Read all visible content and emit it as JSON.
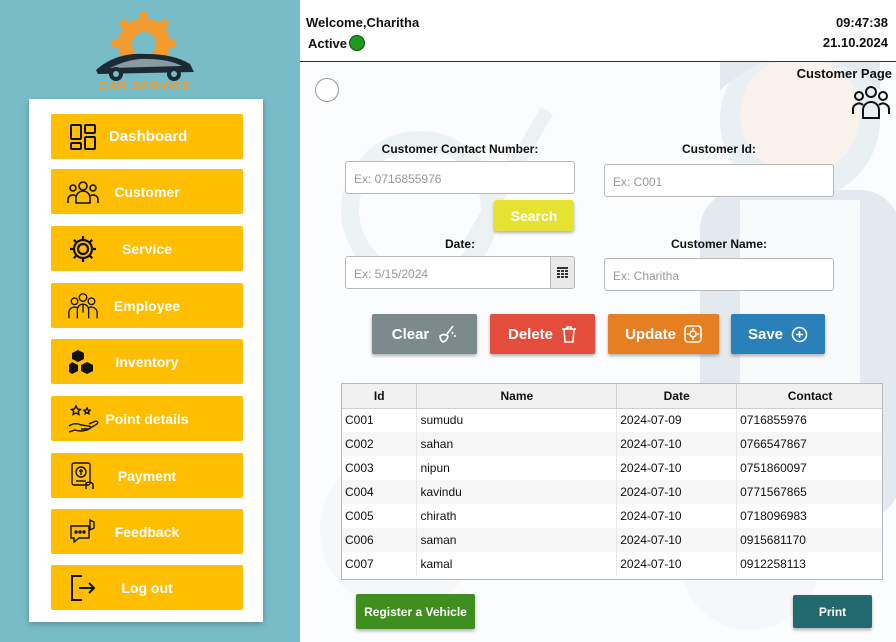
{
  "logo": {
    "text": "CAR SERVICE"
  },
  "sidebar": {
    "items": [
      {
        "label": "Dashboard",
        "icon": "dashboard-icon"
      },
      {
        "label": "Customer",
        "icon": "users-icon"
      },
      {
        "label": "Service",
        "icon": "gear-icon"
      },
      {
        "label": "Employee",
        "icon": "employees-icon"
      },
      {
        "label": "Inventory",
        "icon": "boxes-icon"
      },
      {
        "label": "Point details",
        "icon": "stars-hand-icon"
      },
      {
        "label": "Payment",
        "icon": "payment-icon"
      },
      {
        "label": "Feedback",
        "icon": "feedback-icon"
      },
      {
        "label": "Log out",
        "icon": "logout-icon"
      }
    ]
  },
  "header": {
    "welcome": "Welcome,Charitha",
    "status": "Active",
    "time": "09:47:38",
    "date": "21.10.2024",
    "page_title": "Customer Page"
  },
  "form": {
    "contact_label": "Customer Contact Number:",
    "contact_placeholder": "Ex: 0716855976",
    "id_label": "Customer Id:",
    "id_placeholder": "Ex: C001",
    "search_label": "Search",
    "date_label": "Date:",
    "date_placeholder": "Ex: 5/15/2024",
    "name_label": "Customer Name:",
    "name_placeholder": "Ex: Charitha"
  },
  "actions": {
    "clear": "Clear",
    "delete": "Delete",
    "update": "Update",
    "save": "Save",
    "colors": {
      "clear": "#7b8a8b",
      "delete": "#e44c3c",
      "update": "#e67e22",
      "save": "#2a80b9"
    }
  },
  "table": {
    "columns": [
      "Id",
      "Name",
      "Date",
      "Contact"
    ],
    "rows": [
      [
        "C001",
        "sumudu",
        "2024-07-09",
        "0716855976"
      ],
      [
        "C002",
        "sahan",
        "2024-07-10",
        "0766547867"
      ],
      [
        "C003",
        "nipun",
        "2024-07-10",
        "0751860097"
      ],
      [
        "C004",
        "kavindu",
        "2024-07-10",
        "0771567865"
      ],
      [
        "C005",
        "chirath",
        "2024-07-10",
        "0718096983"
      ],
      [
        "C006",
        "saman",
        "2024-07-10",
        "0915681170"
      ],
      [
        "C007",
        "kamal",
        "2024-07-10",
        "0912258113"
      ]
    ]
  },
  "footer": {
    "register": "Register a Vehicle",
    "print": "Print"
  }
}
